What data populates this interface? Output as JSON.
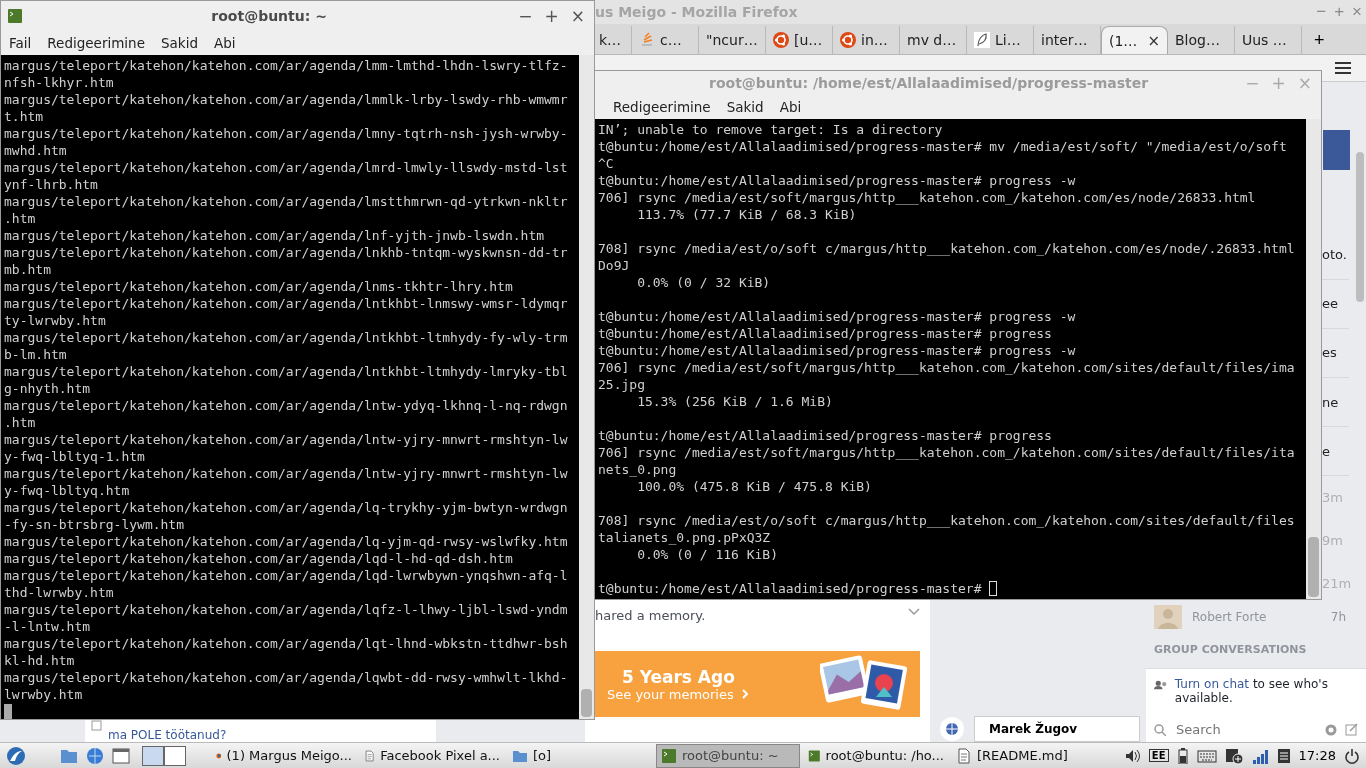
{
  "firefox": {
    "title": "us Meigo - Mozilla Firefox",
    "controls": [
      "−",
      "+",
      "×"
    ],
    "tabs": [
      {
        "label": "k…",
        "selected": false
      },
      {
        "label": "c…",
        "selected": false
      },
      {
        "label": "\"ncur…",
        "selected": false
      },
      {
        "label": "[u…",
        "selected": false
      },
      {
        "label": "in…",
        "selected": false
      },
      {
        "label": "mv d…",
        "selected": false
      },
      {
        "label": "Li…",
        "selected": false
      },
      {
        "label": "inter…",
        "selected": false
      },
      {
        "label": "(1…",
        "selected": true,
        "close": "×"
      },
      {
        "label": "Blog…",
        "selected": false
      },
      {
        "label": "Uus …",
        "selected": false
      }
    ],
    "new_tab": "+",
    "page": {
      "side_fragments": [
        "oto.",
        "ee",
        "es",
        "ne",
        "e"
      ],
      "side_times": [
        "3m",
        "9m",
        "21m"
      ],
      "memory_text": "hared a memory.",
      "banner_title": "5 Years Ago",
      "banner_link": "See your memories",
      "contact": {
        "name": "Robert Forte",
        "time": "7h"
      },
      "section": "GROUP CONVERSATIONS",
      "chat_link": "Turn on chat",
      "chat_text": "to see who's available.",
      "search_placeholder": "Search",
      "chat_tab": "Marek Žugov",
      "left_snippet": "ma POLE töötanud?"
    }
  },
  "terminals": [
    {
      "title": "root@buntu: ~",
      "active": true,
      "controls": [
        "−",
        "+",
        "×"
      ],
      "menu": [
        "Fail",
        "Redigeerimine",
        "Sakid",
        "Abi"
      ],
      "lines": [
        {
          "kind": "text",
          "text": "margus/teleport/katehon/katehon.com/ar/agenda/lmm-lmthd-lhdn-lswry-tlfz-"
        },
        {
          "kind": "text",
          "text": "nfsh-lkhyr.htm"
        },
        {
          "kind": "text",
          "text": "margus/teleport/katehon/katehon.com/ar/agenda/lmmlk-lrby-lswdy-rhb-wmwmr"
        },
        {
          "kind": "text",
          "text": "t.htm"
        },
        {
          "kind": "text",
          "text": "margus/teleport/katehon/katehon.com/ar/agenda/lmny-tqtrh-nsh-jysh-wrwby-"
        },
        {
          "kind": "text",
          "text": "mwhd.htm"
        },
        {
          "kind": "text",
          "text": "margus/teleport/katehon/katehon.com/ar/agenda/lmrd-lmwly-llswdy-mstd-lst"
        },
        {
          "kind": "text",
          "text": "ynf-lhrb.htm"
        },
        {
          "kind": "text",
          "text": "margus/teleport/katehon/katehon.com/ar/agenda/lmstthmrwn-qd-ytrkwn-nkltr"
        },
        {
          "kind": "text",
          "text": ".htm"
        },
        {
          "kind": "text",
          "text": "margus/teleport/katehon/katehon.com/ar/agenda/lnf-yjth-jnwb-lswdn.htm"
        },
        {
          "kind": "text",
          "text": "margus/teleport/katehon/katehon.com/ar/agenda/lnkhb-tntqm-wyskwnsn-dd-tr"
        },
        {
          "kind": "text",
          "text": "mb.htm"
        },
        {
          "kind": "text",
          "text": "margus/teleport/katehon/katehon.com/ar/agenda/lnms-tkhtr-lhry.htm"
        },
        {
          "kind": "text",
          "text": "margus/teleport/katehon/katehon.com/ar/agenda/lntkhbt-lnmswy-wmsr-ldymqr"
        },
        {
          "kind": "text",
          "text": "ty-lwrwby.htm"
        },
        {
          "kind": "text",
          "text": "margus/teleport/katehon/katehon.com/ar/agenda/lntkhbt-ltmhydy-fy-wly-trm"
        },
        {
          "kind": "text",
          "text": "b-lm.htm"
        },
        {
          "kind": "text",
          "text": "margus/teleport/katehon/katehon.com/ar/agenda/lntkhbt-ltmhydy-lmryky-tbl"
        },
        {
          "kind": "text",
          "text": "g-nhyth.htm"
        },
        {
          "kind": "text",
          "text": "margus/teleport/katehon/katehon.com/ar/agenda/lntw-ydyq-lkhnq-l-nq-rdwgn"
        },
        {
          "kind": "text",
          "text": ".htm"
        },
        {
          "kind": "text",
          "text": "margus/teleport/katehon/katehon.com/ar/agenda/lntw-yjry-mnwrt-rmshtyn-lw"
        },
        {
          "kind": "text",
          "text": "y-fwq-lbltyq-1.htm"
        },
        {
          "kind": "text",
          "text": "margus/teleport/katehon/katehon.com/ar/agenda/lntw-yjry-mnwrt-rmshtyn-lw"
        },
        {
          "kind": "text",
          "text": "y-fwq-lbltyq.htm"
        },
        {
          "kind": "text",
          "text": "margus/teleport/katehon/katehon.com/ar/agenda/lq-trykhy-yjm-bwtyn-wrdwgn"
        },
        {
          "kind": "text",
          "text": "-fy-sn-btrsbrg-lywm.htm"
        },
        {
          "kind": "text",
          "text": "margus/teleport/katehon/katehon.com/ar/agenda/lq-yjm-qd-rwsy-wslwfky.htm"
        },
        {
          "kind": "text",
          "text": "margus/teleport/katehon/katehon.com/ar/agenda/lqd-l-hd-qd-dsh.htm"
        },
        {
          "kind": "text",
          "text": "margus/teleport/katehon/katehon.com/ar/agenda/lqd-lwrwbywn-ynqshwn-afq-l"
        },
        {
          "kind": "text",
          "text": "thd-lwrwby.htm"
        },
        {
          "kind": "text",
          "text": "margus/teleport/katehon/katehon.com/ar/agenda/lqfz-l-lhwy-ljbl-lswd-yndm"
        },
        {
          "kind": "text",
          "text": "-l-lntw.htm"
        },
        {
          "kind": "text",
          "text": "margus/teleport/katehon/katehon.com/ar/agenda/lqt-lhnd-wbkstn-ttdhwr-bsh"
        },
        {
          "kind": "text",
          "text": "kl-hd.htm"
        },
        {
          "kind": "text",
          "text": "margus/teleport/katehon/katehon.com/ar/agenda/lqwbt-dd-rwsy-wmhwlt-lkhd-"
        },
        {
          "kind": "text",
          "text": "lwrwby.htm"
        },
        {
          "kind": "prompt"
        }
      ]
    },
    {
      "title": "root@buntu: /home/est/Allalaadimised/progress-master",
      "active": false,
      "controls": [
        "−",
        "+",
        "×"
      ],
      "menu": [
        "Redigeerimine",
        "Sakid",
        "Abi"
      ],
      "lines": [
        {
          "kind": "text",
          "text": "IN’; unable to remove target: Is a directory"
        },
        {
          "kind": "text",
          "text": "t@buntu:/home/est/Allalaadimised/progress-master# mv /media/est/soft/ \"/media/est/o/soft"
        },
        {
          "kind": "text",
          "text": "^C"
        },
        {
          "kind": "text",
          "text": "t@buntu:/home/est/Allalaadimised/progress-master# progress -w"
        },
        {
          "kind": "text",
          "text": "706] rsync /media/est/soft/margus/http___katehon.com_/katehon.com/es/node/26833.html"
        },
        {
          "kind": "text",
          "text": "     113.7% (77.7 KiB / 68.3 KiB)"
        },
        {
          "kind": "blank"
        },
        {
          "kind": "text",
          "text": "708] rsync /media/est/o/soft c/margus/http___katehon.com_/katehon.com/es/node/.26833.html"
        },
        {
          "kind": "text",
          "text": "Do9J"
        },
        {
          "kind": "text",
          "text": "     0.0% (0 / 32 KiB)"
        },
        {
          "kind": "blank"
        },
        {
          "kind": "text",
          "text": "t@buntu:/home/est/Allalaadimised/progress-master# progress -w"
        },
        {
          "kind": "text",
          "text": "t@buntu:/home/est/Allalaadimised/progress-master# progress"
        },
        {
          "kind": "text",
          "text": "t@buntu:/home/est/Allalaadimised/progress-master# progress -w"
        },
        {
          "kind": "text",
          "text": "706] rsync /media/est/soft/margus/http___katehon.com_/katehon.com/sites/default/files/ima"
        },
        {
          "kind": "text",
          "text": "25.jpg"
        },
        {
          "kind": "text",
          "text": "     15.3% (256 KiB / 1.6 MiB)"
        },
        {
          "kind": "blank"
        },
        {
          "kind": "text",
          "text": "t@buntu:/home/est/Allalaadimised/progress-master# progress"
        },
        {
          "kind": "text",
          "text": "706] rsync /media/est/soft/margus/http___katehon.com_/katehon.com/sites/default/files/ita"
        },
        {
          "kind": "text",
          "text": "nets_0.png"
        },
        {
          "kind": "text",
          "text": "     100.0% (475.8 KiB / 475.8 KiB)"
        },
        {
          "kind": "blank"
        },
        {
          "kind": "text",
          "text": "708] rsync /media/est/o/soft c/margus/http___katehon.com_/katehon.com/sites/default/files"
        },
        {
          "kind": "text",
          "text": "talianets_0.png.pPxQ3Z"
        },
        {
          "kind": "text",
          "text": "     0.0% (0 / 116 KiB)"
        },
        {
          "kind": "blank"
        },
        {
          "kind": "prompt",
          "text": "t@buntu:/home/est/Allalaadimised/progress-master# "
        }
      ]
    }
  ],
  "taskbar": {
    "tasks": [
      {
        "label": "(1) Margus Meigo...",
        "selected": false
      },
      {
        "label": "Facebook Pixel  a...",
        "selected": false
      },
      {
        "label": "[o]",
        "selected": false
      },
      {
        "label": "root@buntu: ~",
        "selected": true
      },
      {
        "label": "root@buntu: /ho...",
        "selected": false
      },
      {
        "label": "[README.md]",
        "selected": false
      }
    ],
    "layout": "EE",
    "clock": "17:28"
  }
}
